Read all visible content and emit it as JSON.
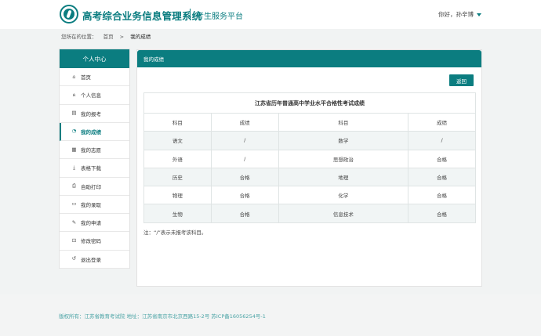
{
  "header": {
    "title": "高考综合业务信息管理系统",
    "subtitle": "考生服务平台",
    "greeting": "你好，孙辛博"
  },
  "breadcrumb": {
    "prefix": "您所在的位置：",
    "home": "首页",
    "separator": ">",
    "current": "我的成绩"
  },
  "sidebar": {
    "title": "个人中心",
    "items": [
      {
        "label": "首页",
        "icon": "home-icon",
        "glyph": "⌂"
      },
      {
        "label": "个人信息",
        "icon": "user-icon",
        "glyph": "ጰ"
      },
      {
        "label": "我的报考",
        "icon": "card-icon",
        "glyph": "▤"
      },
      {
        "label": "我的成绩",
        "icon": "chart-pie-icon",
        "glyph": "◔",
        "active": true
      },
      {
        "label": "我的志愿",
        "icon": "document-icon",
        "glyph": "▦"
      },
      {
        "label": "表格下载",
        "icon": "download-icon",
        "glyph": "⤓"
      },
      {
        "label": "自助打印",
        "icon": "printer-icon",
        "glyph": "⎙"
      },
      {
        "label": "我的录取",
        "icon": "calendar-icon",
        "glyph": "▭"
      },
      {
        "label": "我的申请",
        "icon": "edit-icon",
        "glyph": "✎"
      },
      {
        "label": "修改密码",
        "icon": "lock-icon",
        "glyph": "⊡"
      },
      {
        "label": "退出登录",
        "icon": "logout-icon",
        "glyph": "↺"
      }
    ]
  },
  "main": {
    "panel_title": "我的成绩",
    "back_label": "返回",
    "table_caption": "江苏省历年普通高中学业水平合格性考试成绩",
    "headers": [
      "科目",
      "成绩",
      "科目",
      "成绩"
    ],
    "rows": [
      [
        "语文",
        "/",
        "数学",
        "/"
      ],
      [
        "外语",
        "/",
        "思想政治",
        "合格"
      ],
      [
        "历史",
        "合格",
        "地理",
        "合格"
      ],
      [
        "物理",
        "合格",
        "化学",
        "合格"
      ],
      [
        "生物",
        "合格",
        "信息技术",
        "合格"
      ]
    ],
    "note": "注：“/”表示未报考该科目。"
  },
  "footer": {
    "text": "版权所有：江苏省教育考试院 地址：江苏省南京市北京西路15-2号 苏ICP备16056254号-1"
  },
  "colors": {
    "accent": "#0b7d80",
    "footer_text": "#4aa3a5"
  }
}
